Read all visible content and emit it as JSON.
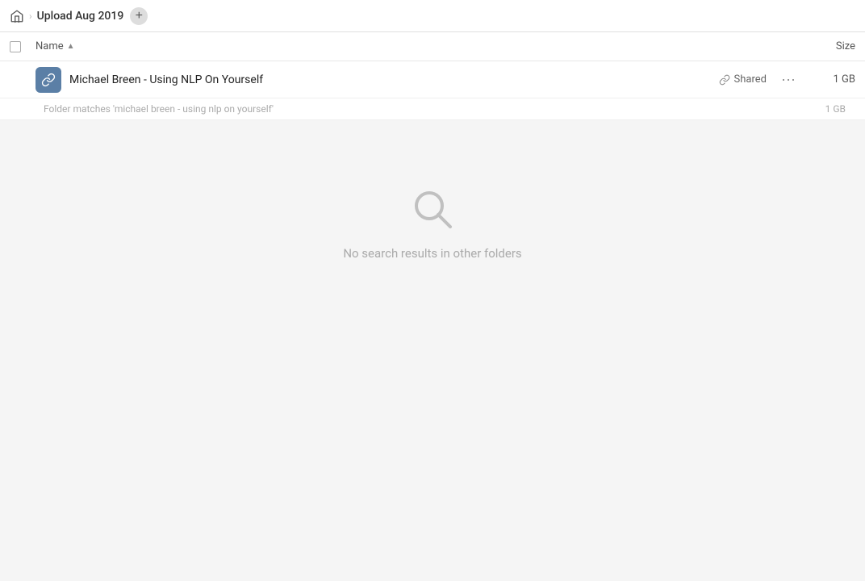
{
  "topbar": {
    "home_title": "Home",
    "breadcrumb_label": "Upload Aug 2019",
    "add_button_label": "+"
  },
  "table_header": {
    "name_label": "Name",
    "sort_arrow": "▲",
    "size_label": "Size"
  },
  "file_row": {
    "name": "Michael Breen - Using NLP On Yourself",
    "shared_label": "Shared",
    "size": "1 GB",
    "more_label": "···"
  },
  "folder_match": {
    "text": "Folder matches 'michael breen - using nlp on yourself'",
    "size": "1 GB"
  },
  "no_results": {
    "text": "No search results in other folders"
  }
}
